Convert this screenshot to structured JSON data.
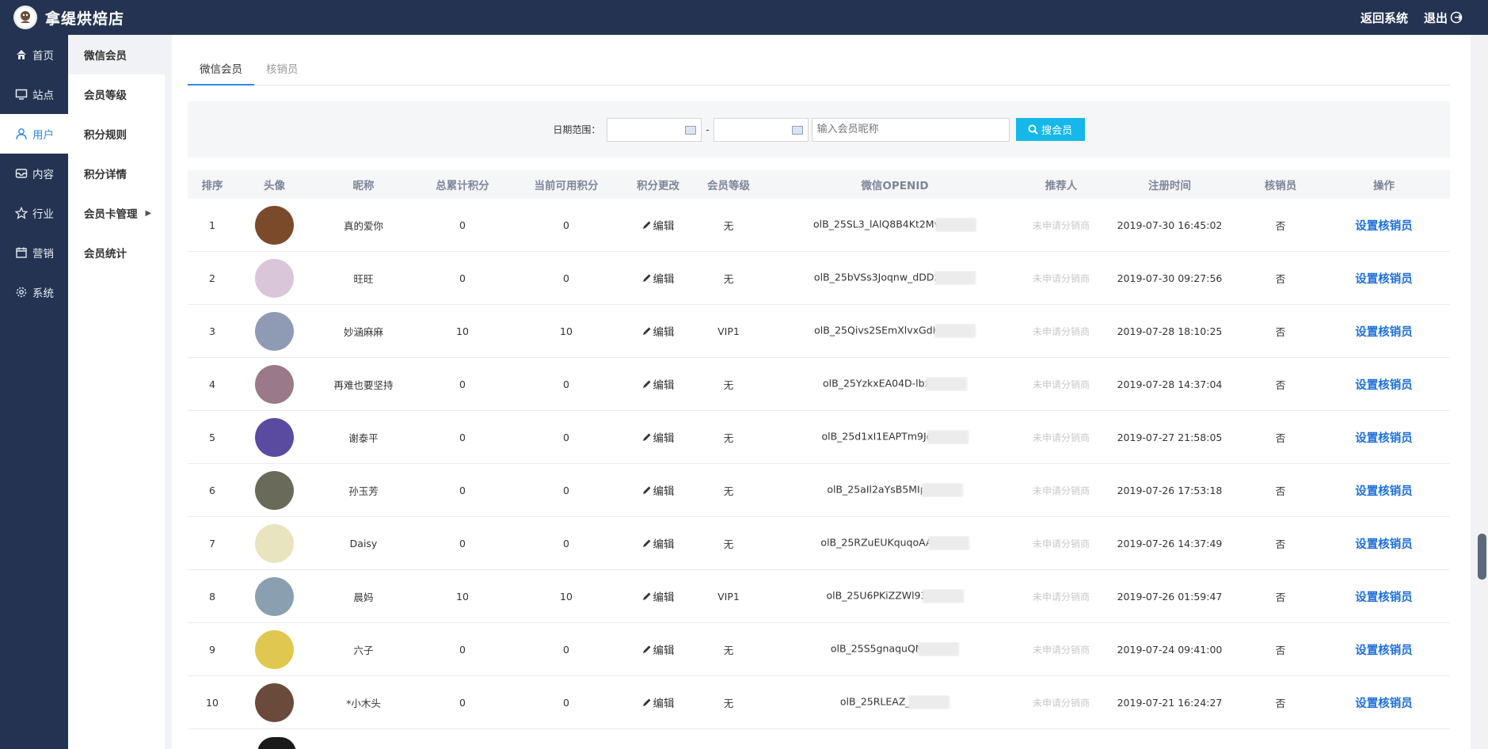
{
  "header": {
    "brand": "拿缇烘焙店",
    "back_label": "返回系统",
    "logout_label": "退出"
  },
  "sidebar": {
    "items": [
      {
        "label": "首页",
        "icon": "home-icon"
      },
      {
        "label": "站点",
        "icon": "monitor-icon"
      },
      {
        "label": "用户",
        "icon": "user-icon",
        "active": true
      },
      {
        "label": "内容",
        "icon": "inbox-icon"
      },
      {
        "label": "行业",
        "icon": "star-icon"
      },
      {
        "label": "营销",
        "icon": "calendar-icon"
      },
      {
        "label": "系统",
        "icon": "gear-icon"
      }
    ]
  },
  "subnav": {
    "items": [
      {
        "label": "微信会员"
      },
      {
        "label": "会员等级"
      },
      {
        "label": "积分规则"
      },
      {
        "label": "积分详情"
      },
      {
        "label": "会员卡管理"
      },
      {
        "label": "会员统计"
      }
    ]
  },
  "tabs": [
    {
      "label": "微信会员",
      "active": true
    },
    {
      "label": "核销员"
    }
  ],
  "search": {
    "date_label": "日期范围：",
    "dash": "-",
    "nickname_placeholder": "输入会员昵称",
    "button_label": "搜会员"
  },
  "table": {
    "columns": [
      "排序",
      "头像",
      "昵称",
      "总累计积分",
      "当前可用积分",
      "积分更改",
      "会员等级",
      "微信OPENID",
      "推荐人",
      "注册时间",
      "核销员",
      "操作"
    ],
    "edit_label": "编辑",
    "referrer_text": "未申请分销商",
    "action_label": "设置核销员",
    "rows": [
      {
        "rank": "1",
        "nickname": "真的爱你",
        "total": "0",
        "current": "0",
        "level": "无",
        "openid": "olB_25SL3_lAlQ8B4Kt2Mv",
        "time": "2019-07-30 16:45:02",
        "writeoff": "否",
        "avatar_color": "#7a4a2a"
      },
      {
        "rank": "2",
        "nickname": "旺旺",
        "total": "0",
        "current": "0",
        "level": "无",
        "openid": "olB_25bVSs3Joqnw_dDDz",
        "time": "2019-07-30 09:27:56",
        "writeoff": "否",
        "avatar_color": "#d9c6d8"
      },
      {
        "rank": "3",
        "nickname": "妙涵麻麻",
        "total": "10",
        "current": "10",
        "level": "VIP1",
        "openid": "olB_25Qivs2SEmXlvxGdK",
        "time": "2019-07-28 18:10:25",
        "writeoff": "否",
        "avatar_color": "#8f9ab5"
      },
      {
        "rank": "4",
        "nickname": "再难也要坚持",
        "total": "0",
        "current": "0",
        "level": "无",
        "openid": "olB_25YzkxEA04D-lbx",
        "time": "2019-07-28 14:37:04",
        "writeoff": "否",
        "avatar_color": "#9a7a8a"
      },
      {
        "rank": "5",
        "nickname": "谢泰平",
        "total": "0",
        "current": "0",
        "level": "无",
        "openid": "olB_25d1xI1EAPTm9Jc",
        "time": "2019-07-27 21:58:05",
        "writeoff": "否",
        "avatar_color": "#5a4aa0"
      },
      {
        "rank": "6",
        "nickname": "孙玉芳",
        "total": "0",
        "current": "0",
        "level": "无",
        "openid": "olB_25aIl2aYsB5MIp",
        "time": "2019-07-26 17:53:18",
        "writeoff": "否",
        "avatar_color": "#6a6a5a"
      },
      {
        "rank": "7",
        "nickname": "Daisy",
        "total": "0",
        "current": "0",
        "level": "无",
        "openid": "olB_25RZuEUKquqoAA",
        "time": "2019-07-26 14:37:49",
        "writeoff": "否",
        "avatar_color": "#e8e4c0"
      },
      {
        "rank": "8",
        "nickname": "晨妈",
        "total": "10",
        "current": "10",
        "level": "VIP1",
        "openid": "olB_25U6PKiZZWl93",
        "time": "2019-07-26 01:59:47",
        "writeoff": "否",
        "avatar_color": "#8aa0b0"
      },
      {
        "rank": "9",
        "nickname": "六子",
        "total": "0",
        "current": "0",
        "level": "无",
        "openid": "olB_25S5gnaquQN",
        "time": "2019-07-24 09:41:00",
        "writeoff": "否",
        "avatar_color": "#e0c850"
      },
      {
        "rank": "10",
        "nickname": "*小木头",
        "total": "0",
        "current": "0",
        "level": "无",
        "openid": "olB_25RLEAZ_l",
        "time": "2019-07-21 16:24:27",
        "writeoff": "否",
        "avatar_color": "#6a4a3a"
      }
    ]
  }
}
